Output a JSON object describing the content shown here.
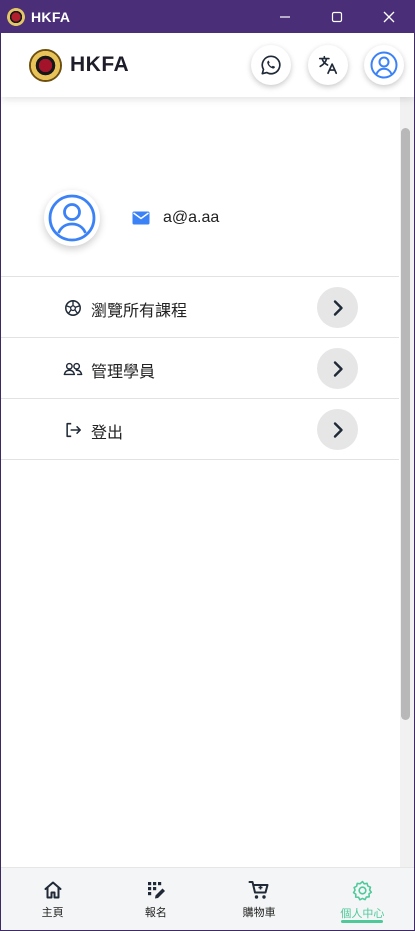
{
  "window": {
    "title": "HKFA",
    "controls": [
      "minimize-icon",
      "maximize-icon",
      "close-icon"
    ]
  },
  "header": {
    "brand": "HKFA",
    "buttons": [
      "whatsapp-icon",
      "translate-icon",
      "profile-icon"
    ]
  },
  "profile": {
    "email": "a@a.aa",
    "avatar_icon": "user-icon",
    "email_icon": "mail-icon"
  },
  "menu": {
    "items": [
      {
        "label": "瀏覽所有課程",
        "icon": "aperture-icon"
      },
      {
        "label": "管理學員",
        "icon": "users-icon"
      },
      {
        "label": "登出",
        "icon": "logout-icon"
      }
    ]
  },
  "bottom_nav": {
    "items": [
      {
        "label": "主頁",
        "icon": "home-icon"
      },
      {
        "label": "報名",
        "icon": "register-icon"
      },
      {
        "label": "購物車",
        "icon": "cart-icon"
      },
      {
        "label": "個人中心",
        "icon": "settings-icon",
        "active": true
      }
    ]
  },
  "colors": {
    "titlebar": "#4a2f78",
    "accent_blue": "#3b82f6",
    "active_green": "#4fc99a"
  }
}
